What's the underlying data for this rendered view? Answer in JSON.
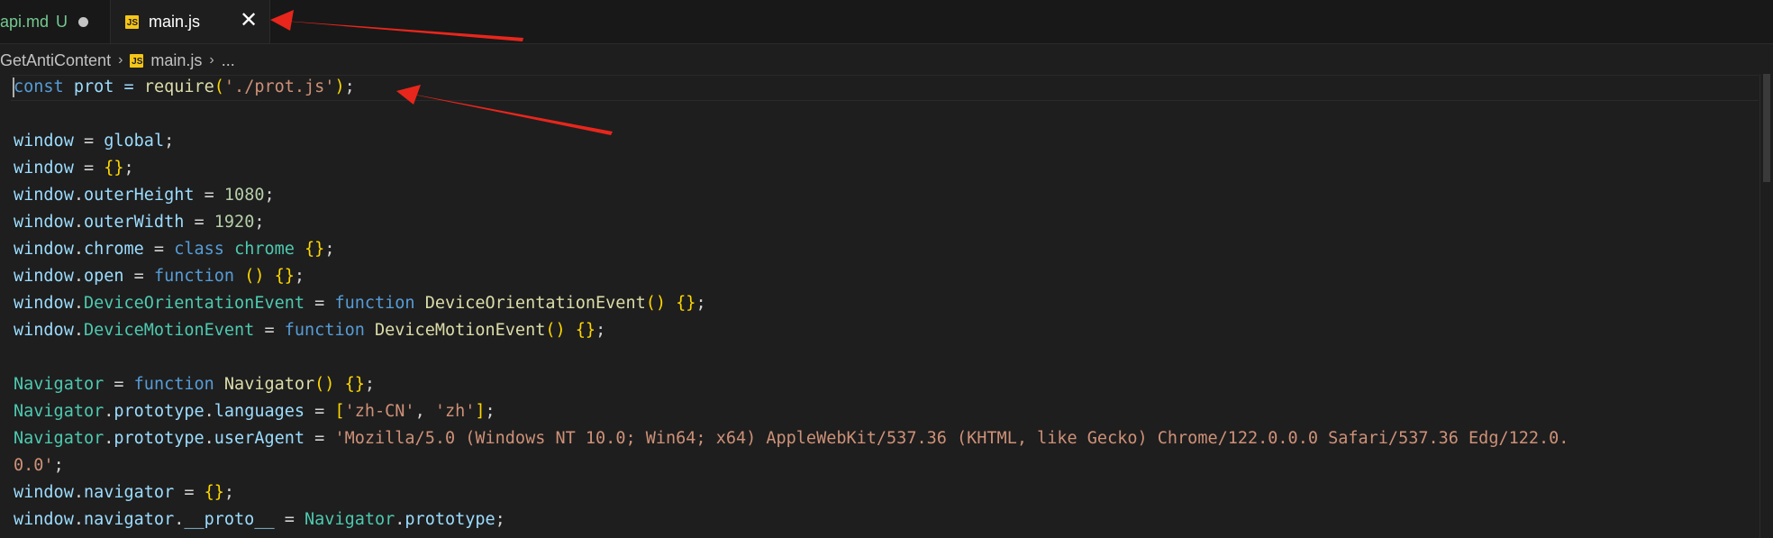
{
  "tabs": [
    {
      "label": "api.md",
      "status": "U",
      "dirty": true
    },
    {
      "label": "main.js",
      "active": true
    }
  ],
  "file_icon": "js-file-icon",
  "breadcrumb": {
    "folder": "GetAntiContent",
    "file": "main.js",
    "more": "..."
  },
  "code": {
    "l1": {
      "a": "const",
      "b": " prot = ",
      "c": "require",
      "d": "(",
      "e": "'./prot.js'",
      "f": ")",
      "g": ";"
    },
    "l3": {
      "a": "window",
      "b": " = ",
      "c": "global",
      "d": ";"
    },
    "l4": {
      "a": "window",
      "b": " = ",
      "c": "{}",
      "d": ";"
    },
    "l5": {
      "a": "window",
      "b": ".",
      "c": "outerHeight",
      "d": " = ",
      "e": "1080",
      "f": ";"
    },
    "l6": {
      "a": "window",
      "b": ".",
      "c": "outerWidth",
      "d": " = ",
      "e": "1920",
      "f": ";"
    },
    "l7": {
      "a": "window",
      "b": ".",
      "c": "chrome",
      "d": " = ",
      "e": "class",
      "f": " ",
      "g": "chrome",
      "h": " ",
      "i": "{}",
      "j": ";"
    },
    "l8": {
      "a": "window",
      "b": ".",
      "c": "open",
      "d": " = ",
      "e": "function",
      "f": " ",
      "g": "()",
      "h": " ",
      "i": "{}",
      "j": ";"
    },
    "l9": {
      "a": "window",
      "b": ".",
      "c": "DeviceOrientationEvent",
      "d": " = ",
      "e": "function",
      "f": " ",
      "g": "DeviceOrientationEvent",
      "h": "()",
      "i": " ",
      "j": "{}",
      "k": ";"
    },
    "l10": {
      "a": "window",
      "b": ".",
      "c": "DeviceMotionEvent",
      "d": " = ",
      "e": "function",
      "f": " ",
      "g": "DeviceMotionEvent",
      "h": "()",
      "i": " ",
      "j": "{}",
      "k": ";"
    },
    "l12": {
      "a": "Navigator",
      "b": " = ",
      "c": "function",
      "d": " ",
      "e": "Navigator",
      "f": "()",
      "g": " ",
      "h": "{}",
      "i": ";"
    },
    "l13": {
      "a": "Navigator",
      "b": ".",
      "c": "prototype",
      "d": ".",
      "e": "languages",
      "f": " = ",
      "g": "[",
      "h": "'zh-CN'",
      "i": ", ",
      "j": "'zh'",
      "k": "]",
      "l": ";"
    },
    "l14": {
      "a": "Navigator",
      "b": ".",
      "c": "prototype",
      "d": ".",
      "e": "userAgent",
      "f": " = ",
      "g": "'Mozilla/5.0 (Windows NT 10.0; Win64; x64) AppleWebKit/537.36 (KHTML, like Gecko) Chrome/122.0.0.0 Safari/537.36 Edg/122.0."
    },
    "l15": {
      "a": "0.0'",
      "b": ";"
    },
    "l16": {
      "a": "window",
      "b": ".",
      "c": "navigator",
      "d": " = ",
      "e": "{}",
      "f": ";"
    },
    "l17": {
      "a": "window",
      "b": ".",
      "c": "navigator",
      "d": ".",
      "e": "__proto__",
      "f": " = ",
      "g": "Navigator",
      "h": ".",
      "i": "prototype",
      "j": ";"
    }
  },
  "colors": {
    "keyword": "#569cd6",
    "variable": "#9cdcfe",
    "function": "#dcdcaa",
    "string": "#ce9178",
    "number": "#b5cea8",
    "class": "#4ec9b0",
    "bracket": "#ffd700",
    "annotation_arrow": "#e8261c"
  }
}
